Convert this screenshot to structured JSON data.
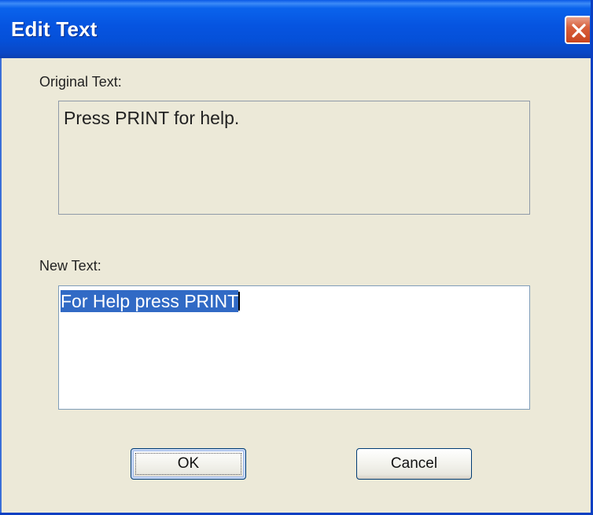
{
  "window": {
    "title": "Edit Text",
    "close_icon": "close-icon"
  },
  "original": {
    "label": "Original Text:",
    "value": "Press PRINT for help."
  },
  "new_text": {
    "label": "New Text:",
    "value": "For Help press PRINT"
  },
  "buttons": {
    "ok_label": "OK",
    "cancel_label": "Cancel"
  },
  "colors": {
    "titlebar": "#0654e0",
    "dialog_bg": "#ece9d8",
    "selection": "#316ac5",
    "close_button": "#d8603c"
  }
}
